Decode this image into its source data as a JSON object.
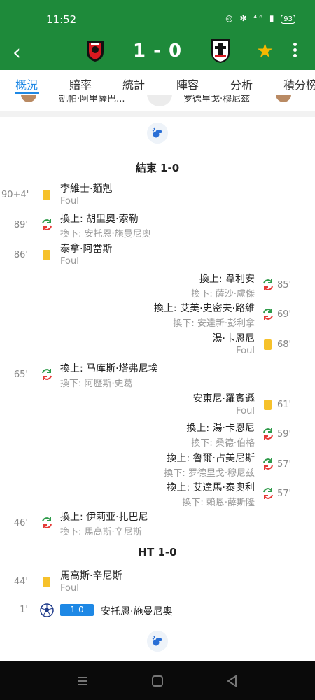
{
  "status": {
    "time": "11:52",
    "icons": "◎ ✻ ⁴⁶ ▮",
    "battery": "93"
  },
  "header": {
    "score": "1 - 0",
    "home_crest": "bournemouth-crest",
    "away_crest": "fulham-crest",
    "star_icon": "star-icon",
    "accent": "#1e8a3a"
  },
  "tabs": [
    {
      "label": "概況",
      "active": true
    },
    {
      "label": "賠率"
    },
    {
      "label": "統計"
    },
    {
      "label": "陣容"
    },
    {
      "label": "分析"
    },
    {
      "label": "積分榜"
    }
  ],
  "prev": {
    "left": "凱帕·阿里薩巴...",
    "right": "罗德里戈·穆尼兹"
  },
  "timeline": {
    "end_label": "結束 1-0",
    "ht_label": "HT 1-0",
    "events": [
      {
        "side": "l",
        "type": "yellow",
        "minute": "90+4'",
        "name": "李維士·麵剋",
        "sub": "Foul"
      },
      {
        "side": "l",
        "type": "subst",
        "minute": "89'",
        "name": "換上: 胡里奧·索勒",
        "sub": "換下: 安托恩·施曼尼奧"
      },
      {
        "side": "l",
        "type": "yellow",
        "minute": "86'",
        "name": "泰拿·阿當斯",
        "sub": "Foul"
      },
      {
        "side": "r",
        "type": "subst",
        "minute": "85'",
        "name": "換上: 韋利安",
        "sub": "換下: 薩沙·盧傑"
      },
      {
        "side": "r",
        "type": "subst",
        "minute": "69'",
        "name": "換上: 艾美·史密夫·路維",
        "sub": "換下: 安達新·彭利拿"
      },
      {
        "side": "r",
        "type": "yellow",
        "minute": "68'",
        "name": "湯·卡恩尼",
        "sub": "Foul"
      },
      {
        "side": "l",
        "type": "subst",
        "minute": "65'",
        "name": "換上: 马库斯·塔弗尼埃",
        "sub": "換下: 阿歷斯·史葛"
      },
      {
        "side": "r",
        "type": "yellow",
        "minute": "61'",
        "name": "安東尼·羅賓遜",
        "sub": "Foul"
      },
      {
        "side": "r",
        "type": "subst",
        "minute": "59'",
        "name": "換上: 湯·卡恩尼",
        "sub": "換下: 桑德·伯格"
      },
      {
        "side": "r",
        "type": "subst",
        "minute": "57'",
        "name": "換上: 魯爾·占美尼斯",
        "sub": "換下: 罗德里戈·穆尼兹"
      },
      {
        "side": "r",
        "type": "subst",
        "minute": "57'",
        "name": "換上: 艾達馬·泰奧利",
        "sub": "換下: 賴恩·薛斯隆"
      },
      {
        "side": "l",
        "type": "subst",
        "minute": "46'",
        "name": "換上: 伊莉亚·扎巴尼",
        "sub": "換下: 馬高斯·辛尼斯"
      },
      {
        "side": "l",
        "type": "yellow",
        "minute": "44'",
        "name": "馬高斯·辛尼斯",
        "sub": "Foul"
      },
      {
        "side": "l",
        "type": "goal",
        "minute": "1'",
        "name": "安托恩·施曼尼奧",
        "badge": "1-0"
      }
    ]
  },
  "colors": {
    "yellow_card": "#f6c12b",
    "sub_in": "#2e9b4a",
    "sub_out": "#e53935",
    "link_blue": "#1e88e5"
  }
}
